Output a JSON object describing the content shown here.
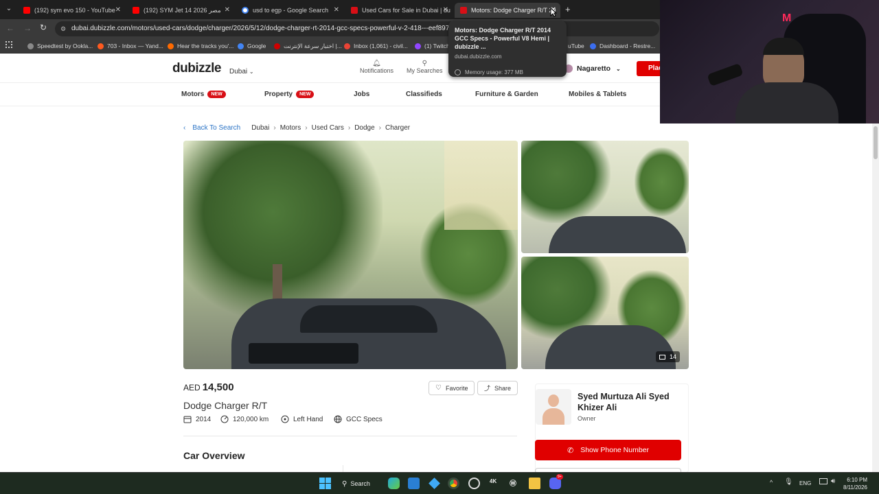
{
  "browser": {
    "tabs": [
      {
        "label": "(192) sym evo 150 - YouTube",
        "favicon_color": "#ff0000"
      },
      {
        "label": "(192) SYM Jet 14 2026 مصر",
        "favicon_color": "#ff0000"
      },
      {
        "label": "usd to egp - Google Search",
        "favicon_color": "#4285f4"
      },
      {
        "label": "Used Cars for Sale in Dubai | du",
        "favicon_color": "#d80f16"
      },
      {
        "label": "Motors: Dodge Charger R/T 20",
        "favicon_color": "#d80f16"
      }
    ],
    "new_tab_symbol": "+",
    "url": "dubai.dubizzle.com/motors/used-cars/dodge/charger/2026/5/12/dodge-charger-rt-2014-gcc-specs-powerful-v-2-418---eef897fc4cc",
    "bookmarks": [
      {
        "label": "Speedtest by Ookla...",
        "color": "#8a8a8a"
      },
      {
        "label": "703 - Inbox — Yand...",
        "color": "#ff5a1f"
      },
      {
        "label": "Hear the tracks you'...",
        "color": "#ff6a00"
      },
      {
        "label": "Google",
        "color": "#4285f4"
      },
      {
        "label": "اختبار سرعة الإنترنت |...",
        "color": "#d00000"
      },
      {
        "label": "Inbox (1,061) - civil...",
        "color": "#ea4335"
      },
      {
        "label": "(1) Twitch",
        "color": "#9146ff"
      },
      {
        "label": "uTube",
        "color": "#ff0000"
      },
      {
        "label": "Dashboard - Restre...",
        "color": "#3b6ef0"
      }
    ]
  },
  "tooltip": {
    "title": "Motors: Dodge Charger R/T 2014 GCC Specs - Powerful V8 Hemi | dubizzle ...",
    "domain": "dubai.dubizzle.com",
    "memory": "Memory usage: 377 MB"
  },
  "site": {
    "logo": "dubizzle",
    "city": "Dubai",
    "notifications": "Notifications",
    "my_searches": "My Searches",
    "username": "Nagaretto",
    "place_ad": "Plac",
    "brand_color": "#e00000"
  },
  "categories": [
    {
      "label": "Motors",
      "badge": "NEW"
    },
    {
      "label": "Property",
      "badge": "NEW"
    },
    {
      "label": "Jobs",
      "badge": ""
    },
    {
      "label": "Classifieds",
      "badge": ""
    },
    {
      "label": "Furniture & Garden",
      "badge": ""
    },
    {
      "label": "Mobiles & Tablets",
      "badge": ""
    }
  ],
  "breadcrumb": {
    "back": "Back To Search",
    "items": [
      "Dubai",
      "Motors",
      "Used Cars",
      "Dodge",
      "Charger"
    ]
  },
  "gallery": {
    "photo_count": "14"
  },
  "listing": {
    "currency": "AED",
    "price": "14,500",
    "title": "Dodge Charger R/T",
    "year": "2014",
    "mileage": "120,000 km",
    "steering": "Left Hand",
    "specs": "GCC Specs",
    "favorite": "Favorite",
    "share": "Share",
    "overview_heading": "Car Overview"
  },
  "seller": {
    "name": "Syed Murtuza Ali Syed Khizer Ali",
    "role": "Owner",
    "phone_button": "Show Phone Number"
  },
  "taskbar": {
    "search": "Search",
    "lang": "ENG",
    "time": "6:10 PM",
    "date": "8/11/2026",
    "discord_badge": "9+"
  }
}
